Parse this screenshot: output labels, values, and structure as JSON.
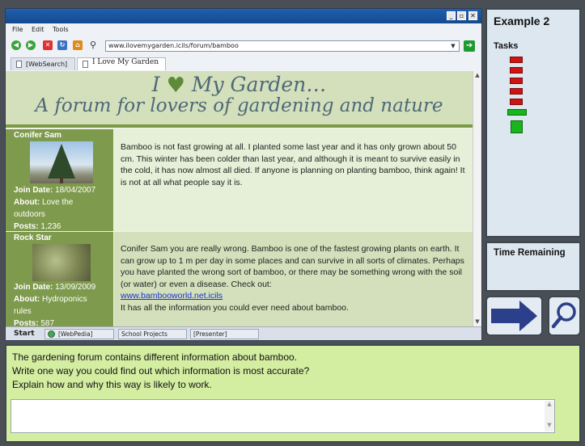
{
  "example_panel": {
    "title": "Example 2",
    "tasks_label": "Tasks",
    "colors": {
      "incomplete": "#cf1212",
      "complete": "#18b51d"
    }
  },
  "time_panel": {
    "label": "Time Remaining"
  },
  "browser": {
    "menu": [
      "File",
      "Edit",
      "Tools"
    ],
    "address": "www.ilovemygarden.icils/forum/bamboo",
    "tabs": [
      "[WebSearch]",
      "I Love My Garden"
    ],
    "taskbar": [
      "Start",
      "[WebPedia]",
      "School Projects",
      "[Presenter]"
    ]
  },
  "site": {
    "title_pre": "I",
    "title_post": "My Garden…",
    "subtitle": "A forum for lovers of gardening and nature"
  },
  "posts": [
    {
      "author": "Conifer Sam",
      "join_label": "Join Date:",
      "join_date": "18/04/2007",
      "about_label": "About:",
      "about_1": "Love the",
      "about_2": "outdoors",
      "posts_label": "Posts:",
      "posts_count": "1,236",
      "body": "Bamboo is not fast growing at all. I planted some last year and it has only grown about 50 cm. This winter has been colder than last year, and although it is meant to survive easily in the cold, it has now almost all died. If anyone is planning on planting bamboo, think again! It is not at all what people say it is."
    },
    {
      "author": "Rock Star",
      "join_label": "Join Date:",
      "join_date": "13/09/2009",
      "about_label": "About:",
      "about_1": "Hydroponics",
      "about_2": "rules",
      "posts_label": "Posts:",
      "posts_count": "587",
      "body": "Conifer Sam you are really wrong. Bamboo is one of the fastest growing plants on earth. It can grow up to 1 m per day in some places and can survive in all sorts of climates. Perhaps you have planted the wrong sort of bamboo, or there may be something wrong with the soil (or water) or even a disease. Check out:",
      "link": "www.bambooworld.net.icils",
      "body_after": "It has all the information you could ever need about bamboo."
    }
  ],
  "question": {
    "line1": "The gardening forum contains different information about bamboo.",
    "line2": "Write one way you could find out which information is most accurate?",
    "line3": "Explain how and why this way is likely to work.",
    "answer": ""
  }
}
